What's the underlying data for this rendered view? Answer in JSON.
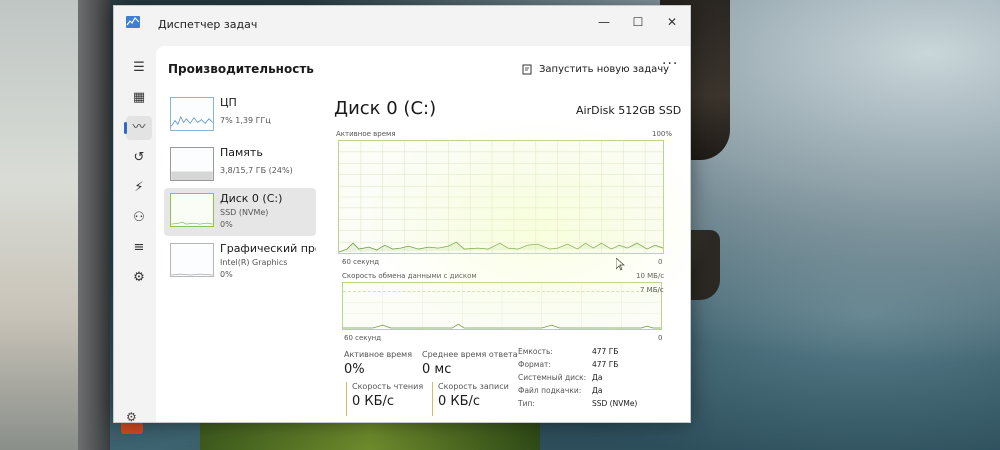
{
  "window": {
    "title": "Диспетчер задач",
    "minimize": "—",
    "maximize": "☐",
    "close": "✕"
  },
  "nav": {
    "items": [
      {
        "icon": "hamburger-icon",
        "glyph": "☰"
      },
      {
        "icon": "processes-icon",
        "glyph": "▦"
      },
      {
        "icon": "performance-icon",
        "glyph": "〰"
      },
      {
        "icon": "app-history-icon",
        "glyph": "↺"
      },
      {
        "icon": "startup-apps-icon",
        "glyph": "⚡"
      },
      {
        "icon": "users-icon",
        "glyph": "⚇"
      },
      {
        "icon": "details-icon",
        "glyph": "≡"
      },
      {
        "icon": "services-icon",
        "glyph": "⚙"
      }
    ],
    "settings_glyph": "⚙"
  },
  "header": {
    "title": "Производительность",
    "run_task_label": "Запустить новую задачу",
    "more_label": "···"
  },
  "resources": [
    {
      "name": "ЦП",
      "sub1": "7% 1,39 ГГц",
      "sub2": ""
    },
    {
      "name": "Память",
      "sub1": "3,8/15,7 ГБ (24%)",
      "sub2": ""
    },
    {
      "name": "Диск 0 (C:)",
      "sub1": "SSD (NVMe)",
      "sub2": "0%"
    },
    {
      "name": "Графический про",
      "sub1": "Intel(R) Graphics",
      "sub2": "0%"
    }
  ],
  "disk": {
    "title": "Диск 0 (C:)",
    "model": "AirDisk 512GB SSD",
    "active_time_label": "Активное время",
    "active_time_max": "100%",
    "graph1_time": "60 секунд",
    "graph1_min": "0",
    "transfer_label": "Скорость обмена данными с диском",
    "transfer_max": "10 МБ/с",
    "transfer_mid": "7 МБ/с",
    "graph2_time": "60 секунд",
    "graph2_min": "0",
    "stats": {
      "active_time_label": "Активное время",
      "active_time_value": "0%",
      "response_label": "Среднее время ответа",
      "response_value": "0 мс",
      "read_label": "Скорость чтения",
      "read_value": "0 КБ/с",
      "write_label": "Скорость записи",
      "write_value": "0 КБ/с"
    },
    "properties": [
      {
        "key": "Емкость:",
        "value": "477 ГБ"
      },
      {
        "key": "Формат:",
        "value": "477 ГБ"
      },
      {
        "key": "Системный диск:",
        "value": "Да"
      },
      {
        "key": "Файл подкачки:",
        "value": "Да"
      },
      {
        "key": "Тип:",
        "value": "SSD (NVMe)"
      }
    ]
  },
  "colors": {
    "disk_accent": "#8fbf5a",
    "cpu_accent": "#5b8fc7",
    "nav_accent": "#2e6cc4"
  }
}
